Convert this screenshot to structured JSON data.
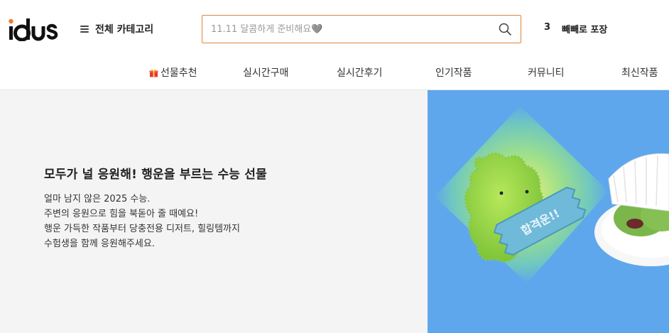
{
  "brand": {
    "logo_text": "idus",
    "accent_color": "#e0853c"
  },
  "header": {
    "category_label": "전체 카테고리",
    "search": {
      "placeholder": "11.11 달콤하게 준비해요🩶",
      "value": ""
    },
    "promo": {
      "number": "3",
      "text": "빼빼로 포장"
    }
  },
  "nav": {
    "items": [
      {
        "label": "선물추천",
        "icon": "gift-icon"
      },
      {
        "label": "실시간구매"
      },
      {
        "label": "실시간후기"
      },
      {
        "label": "인기작품"
      },
      {
        "label": "커뮤니티"
      },
      {
        "label": "최신작품"
      }
    ]
  },
  "hero": {
    "title": "모두가 널 응원해! 행운을 부르는 수능 선물",
    "description": [
      "얼마 남지 않은 2025 수능.",
      "주변의 응원으로 힘을 북돋아 줄 때예요!",
      "행운 가득한 작품부터 당충전용 디저트, 힐링템까지",
      "수험생을 함께 응원해주세요."
    ],
    "image": {
      "tag_text": "합격운!!",
      "background_color": "#5fa7ec"
    }
  }
}
